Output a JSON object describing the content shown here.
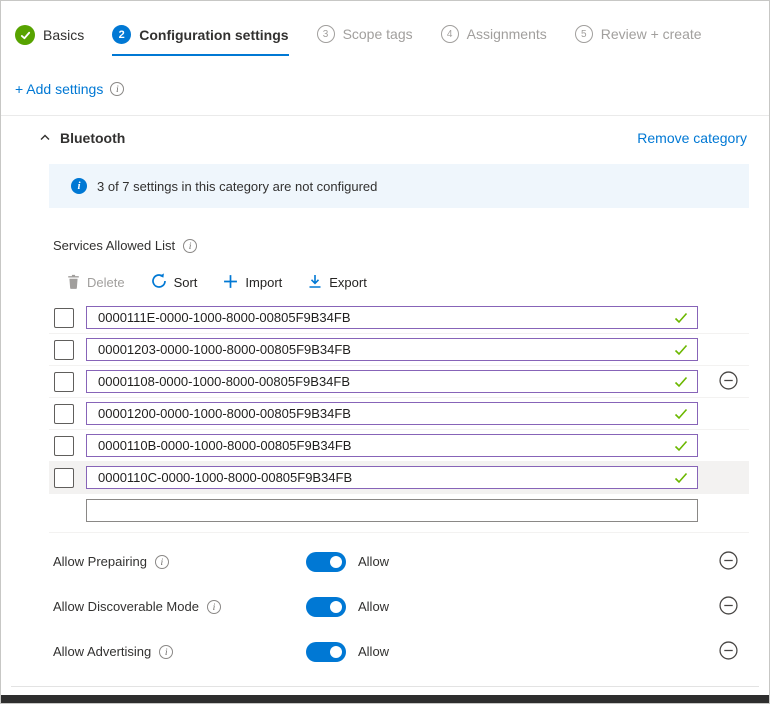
{
  "stepper": {
    "steps": [
      {
        "label": "Basics",
        "state": "complete"
      },
      {
        "number": "2",
        "label": "Configuration settings",
        "state": "active"
      },
      {
        "number": "3",
        "label": "Scope tags",
        "state": "upcoming"
      },
      {
        "number": "4",
        "label": "Assignments",
        "state": "upcoming"
      },
      {
        "number": "5",
        "label": "Review + create",
        "state": "upcoming"
      }
    ]
  },
  "add_settings": {
    "label": "+ Add settings"
  },
  "category": {
    "title": "Bluetooth",
    "remove_label": "Remove category",
    "banner_text": "3 of 7 settings in this category are not configured"
  },
  "list": {
    "label": "Services Allowed List",
    "toolbar": {
      "delete": "Delete",
      "sort": "Sort",
      "import": "Import",
      "export": "Export"
    },
    "values": [
      "0000111E-0000-1000-8000-00805F9B34FB",
      "00001203-0000-1000-8000-00805F9B34FB",
      "00001108-0000-1000-8000-00805F9B34FB",
      "00001200-0000-1000-8000-00805F9B34FB",
      "0000110B-0000-1000-8000-00805F9B34FB",
      "0000110C-0000-1000-8000-00805F9B34FB"
    ],
    "empty_value": ""
  },
  "toggles": [
    {
      "label": "Allow Prepairing",
      "value": "Allow",
      "on": true
    },
    {
      "label": "Allow Discoverable Mode",
      "value": "Allow",
      "on": true
    },
    {
      "label": "Allow Advertising",
      "value": "Allow",
      "on": true
    }
  ],
  "icons": {
    "info_glyph": "i"
  },
  "colors": {
    "accent_blue": "#0078D4",
    "success_green": "#57A300",
    "valid_check_green": "#6BB700",
    "modified_border_purple": "#8764B8",
    "banner_bg": "#EFF6FC",
    "disabled_gray": "#A19F9D",
    "bottom_bar": "#2E2E2E"
  }
}
